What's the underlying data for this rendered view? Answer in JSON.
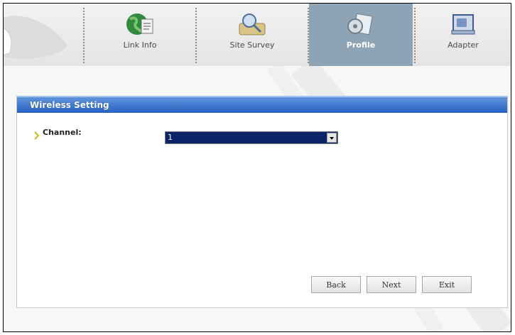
{
  "nav": {
    "tabs": [
      {
        "label": "Link Info",
        "icon": "globe-icon"
      },
      {
        "label": "Site Survey",
        "icon": "site-survey-icon"
      },
      {
        "label": "Profile",
        "icon": "profile-icon",
        "active": true
      },
      {
        "label": "Adapter",
        "icon": "adapter-icon"
      }
    ]
  },
  "panel": {
    "title": "Wireless Setting",
    "channel_label": "Channel:",
    "channel_value": "1"
  },
  "buttons": {
    "back": "Back",
    "next": "Next",
    "exit": "Exit"
  },
  "colors": {
    "header_blue": "#2763c3",
    "active_tab": "#8ea3b3",
    "select_bg": "#0a246a",
    "arrow": "#d4b800"
  }
}
